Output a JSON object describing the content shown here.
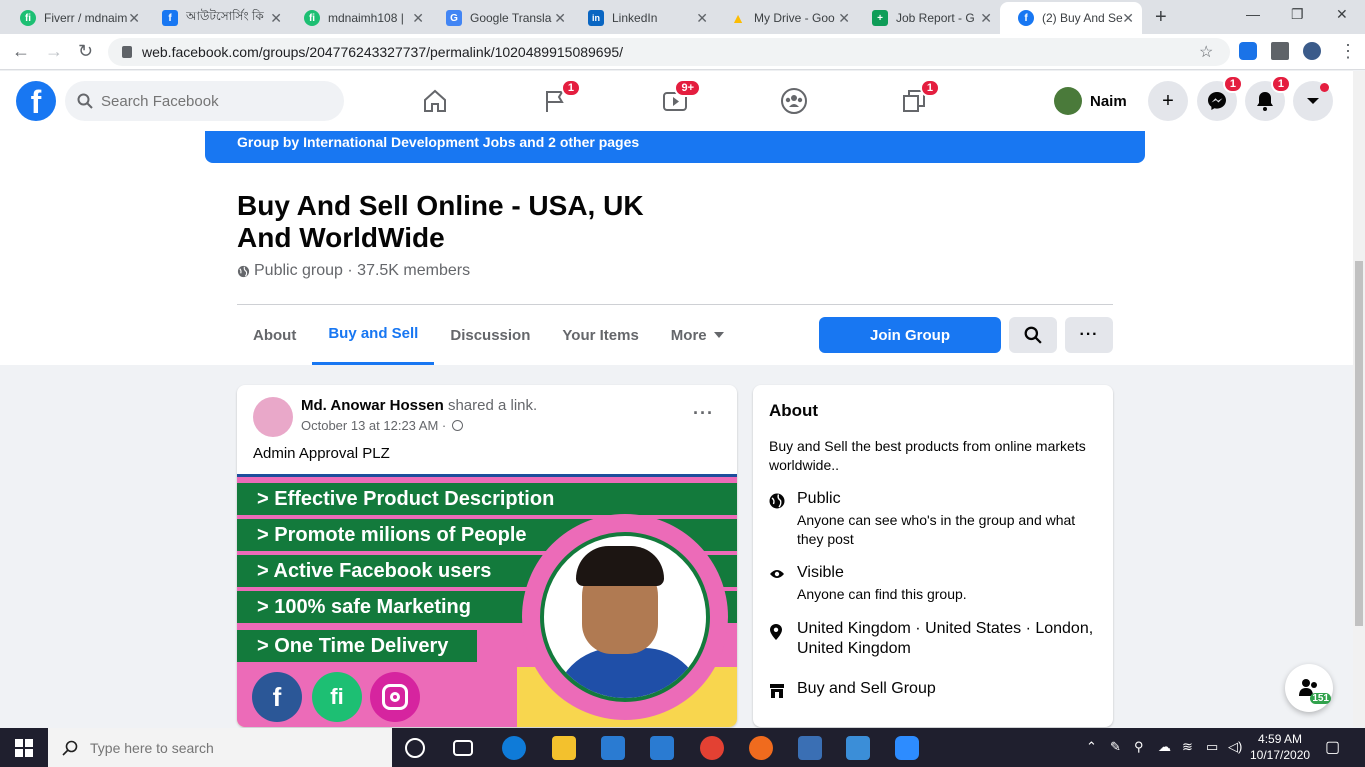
{
  "browser": {
    "tabs": [
      {
        "label": "Fiverr / mdnaim",
        "color": "#1dbf73",
        "glyph": "fi"
      },
      {
        "label": "আউটসোর্সিং কি",
        "color": "#1877f2",
        "glyph": "f"
      },
      {
        "label": "mdnaimh108 |",
        "color": "#1dbf73",
        "glyph": "fi"
      },
      {
        "label": "Google Transla",
        "color": "#4285f4",
        "glyph": "G"
      },
      {
        "label": "LinkedIn",
        "color": "#0a66c2",
        "glyph": "in"
      },
      {
        "label": "My Drive - Goo",
        "color": "#fbbc04",
        "glyph": "▲"
      },
      {
        "label": "Job Report - G",
        "color": "#0f9d58",
        "glyph": "+"
      },
      {
        "label": "(2) Buy And Se",
        "color": "#1877f2",
        "glyph": "f"
      }
    ],
    "url": "web.facebook.com/groups/204776243327737/permalink/1020489915089695/"
  },
  "header": {
    "search_placeholder": "Search Facebook",
    "badges": {
      "pages": "1",
      "watch": "9+",
      "gaming": "1",
      "messenger": "1",
      "notifications": "1"
    },
    "profile_name": "Naim"
  },
  "group": {
    "banner": "Group by International Development Jobs and 2 other pages",
    "title": "Buy And Sell Online - USA, UK And WorldWide",
    "meta": "Public group · 37.5K members",
    "tabs": [
      "About",
      "Buy and Sell",
      "Discussion",
      "Your Items",
      "More"
    ],
    "join_label": "Join Group"
  },
  "post": {
    "author": "Md. Anowar Hossen",
    "action": " shared a link.",
    "date": "October 13 at 12:23 AM ·",
    "text": "Admin Approval PLZ",
    "image_lines": [
      "> Effective Product Description",
      "> Promote milions of People",
      "> Active Facebook users",
      "> 100% safe Marketing",
      "> One Time Delivery"
    ]
  },
  "about": {
    "heading": "About",
    "description": "Buy and Sell the best products from online markets worldwide..",
    "public_title": "Public",
    "public_desc": "Anyone can see who's in the group and what they post",
    "visible_title": "Visible",
    "visible_desc": "Anyone can find this group.",
    "location": "United Kingdom · United States · London, United Kingdom",
    "category": "Buy and Sell Group"
  },
  "float_badge": "151",
  "taskbar": {
    "search_placeholder": "Type here to search",
    "time": "4:59 AM",
    "date": "10/17/2020"
  }
}
